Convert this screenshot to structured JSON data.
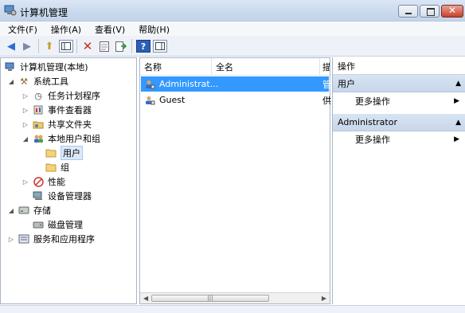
{
  "window": {
    "title": "计算机管理"
  },
  "menu": [
    "文件(F)",
    "操作(A)",
    "查看(V)",
    "帮助(H)"
  ],
  "toolbar": [
    "back-icon",
    "forward-icon",
    "up-icon",
    "show-hide-tree-icon",
    "delete-icon",
    "properties-icon",
    "export-icon",
    "help-icon",
    "show-hide-actions-icon"
  ],
  "tree": {
    "root": "计算机管理(本地)",
    "system_tools": "系统工具",
    "task_scheduler": "任务计划程序",
    "event_viewer": "事件查看器",
    "shared_folders": "共享文件夹",
    "local_users": "本地用户和组",
    "users": "用户",
    "groups": "组",
    "performance": "性能",
    "device_manager": "设备管理器",
    "storage": "存储",
    "disk_management": "磁盘管理",
    "services_apps": "服务和应用程序"
  },
  "list": {
    "columns": [
      "名称",
      "全名",
      "描"
    ],
    "rows": [
      {
        "name": "Administrat...",
        "fullname": "",
        "desc": "管"
      },
      {
        "name": "Guest",
        "fullname": "",
        "desc": "供"
      }
    ]
  },
  "actions": {
    "title": "操作",
    "group1": "用户",
    "group1_more": "更多操作",
    "group2": "Administrator",
    "group2_more": "更多操作"
  },
  "colors": {
    "selection": "#3399ff",
    "action_header": "#c7d6ea"
  }
}
